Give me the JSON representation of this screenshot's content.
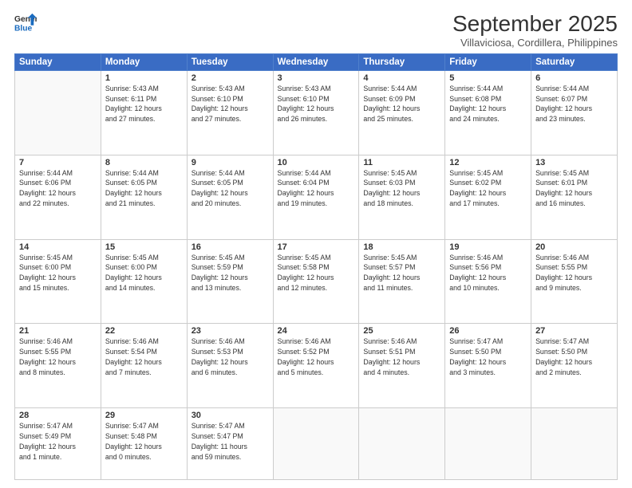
{
  "header": {
    "logo_general": "General",
    "logo_blue": "Blue",
    "title": "September 2025",
    "subtitle": "Villaviciosa, Cordillera, Philippines"
  },
  "weekdays": [
    "Sunday",
    "Monday",
    "Tuesday",
    "Wednesday",
    "Thursday",
    "Friday",
    "Saturday"
  ],
  "weeks": [
    [
      {
        "day": "",
        "detail": ""
      },
      {
        "day": "1",
        "detail": "Sunrise: 5:43 AM\nSunset: 6:11 PM\nDaylight: 12 hours\nand 27 minutes."
      },
      {
        "day": "2",
        "detail": "Sunrise: 5:43 AM\nSunset: 6:10 PM\nDaylight: 12 hours\nand 27 minutes."
      },
      {
        "day": "3",
        "detail": "Sunrise: 5:43 AM\nSunset: 6:10 PM\nDaylight: 12 hours\nand 26 minutes."
      },
      {
        "day": "4",
        "detail": "Sunrise: 5:44 AM\nSunset: 6:09 PM\nDaylight: 12 hours\nand 25 minutes."
      },
      {
        "day": "5",
        "detail": "Sunrise: 5:44 AM\nSunset: 6:08 PM\nDaylight: 12 hours\nand 24 minutes."
      },
      {
        "day": "6",
        "detail": "Sunrise: 5:44 AM\nSunset: 6:07 PM\nDaylight: 12 hours\nand 23 minutes."
      }
    ],
    [
      {
        "day": "7",
        "detail": "Sunrise: 5:44 AM\nSunset: 6:06 PM\nDaylight: 12 hours\nand 22 minutes."
      },
      {
        "day": "8",
        "detail": "Sunrise: 5:44 AM\nSunset: 6:05 PM\nDaylight: 12 hours\nand 21 minutes."
      },
      {
        "day": "9",
        "detail": "Sunrise: 5:44 AM\nSunset: 6:05 PM\nDaylight: 12 hours\nand 20 minutes."
      },
      {
        "day": "10",
        "detail": "Sunrise: 5:44 AM\nSunset: 6:04 PM\nDaylight: 12 hours\nand 19 minutes."
      },
      {
        "day": "11",
        "detail": "Sunrise: 5:45 AM\nSunset: 6:03 PM\nDaylight: 12 hours\nand 18 minutes."
      },
      {
        "day": "12",
        "detail": "Sunrise: 5:45 AM\nSunset: 6:02 PM\nDaylight: 12 hours\nand 17 minutes."
      },
      {
        "day": "13",
        "detail": "Sunrise: 5:45 AM\nSunset: 6:01 PM\nDaylight: 12 hours\nand 16 minutes."
      }
    ],
    [
      {
        "day": "14",
        "detail": "Sunrise: 5:45 AM\nSunset: 6:00 PM\nDaylight: 12 hours\nand 15 minutes."
      },
      {
        "day": "15",
        "detail": "Sunrise: 5:45 AM\nSunset: 6:00 PM\nDaylight: 12 hours\nand 14 minutes."
      },
      {
        "day": "16",
        "detail": "Sunrise: 5:45 AM\nSunset: 5:59 PM\nDaylight: 12 hours\nand 13 minutes."
      },
      {
        "day": "17",
        "detail": "Sunrise: 5:45 AM\nSunset: 5:58 PM\nDaylight: 12 hours\nand 12 minutes."
      },
      {
        "day": "18",
        "detail": "Sunrise: 5:45 AM\nSunset: 5:57 PM\nDaylight: 12 hours\nand 11 minutes."
      },
      {
        "day": "19",
        "detail": "Sunrise: 5:46 AM\nSunset: 5:56 PM\nDaylight: 12 hours\nand 10 minutes."
      },
      {
        "day": "20",
        "detail": "Sunrise: 5:46 AM\nSunset: 5:55 PM\nDaylight: 12 hours\nand 9 minutes."
      }
    ],
    [
      {
        "day": "21",
        "detail": "Sunrise: 5:46 AM\nSunset: 5:55 PM\nDaylight: 12 hours\nand 8 minutes."
      },
      {
        "day": "22",
        "detail": "Sunrise: 5:46 AM\nSunset: 5:54 PM\nDaylight: 12 hours\nand 7 minutes."
      },
      {
        "day": "23",
        "detail": "Sunrise: 5:46 AM\nSunset: 5:53 PM\nDaylight: 12 hours\nand 6 minutes."
      },
      {
        "day": "24",
        "detail": "Sunrise: 5:46 AM\nSunset: 5:52 PM\nDaylight: 12 hours\nand 5 minutes."
      },
      {
        "day": "25",
        "detail": "Sunrise: 5:46 AM\nSunset: 5:51 PM\nDaylight: 12 hours\nand 4 minutes."
      },
      {
        "day": "26",
        "detail": "Sunrise: 5:47 AM\nSunset: 5:50 PM\nDaylight: 12 hours\nand 3 minutes."
      },
      {
        "day": "27",
        "detail": "Sunrise: 5:47 AM\nSunset: 5:50 PM\nDaylight: 12 hours\nand 2 minutes."
      }
    ],
    [
      {
        "day": "28",
        "detail": "Sunrise: 5:47 AM\nSunset: 5:49 PM\nDaylight: 12 hours\nand 1 minute."
      },
      {
        "day": "29",
        "detail": "Sunrise: 5:47 AM\nSunset: 5:48 PM\nDaylight: 12 hours\nand 0 minutes."
      },
      {
        "day": "30",
        "detail": "Sunrise: 5:47 AM\nSunset: 5:47 PM\nDaylight: 11 hours\nand 59 minutes."
      },
      {
        "day": "",
        "detail": ""
      },
      {
        "day": "",
        "detail": ""
      },
      {
        "day": "",
        "detail": ""
      },
      {
        "day": "",
        "detail": ""
      }
    ]
  ]
}
